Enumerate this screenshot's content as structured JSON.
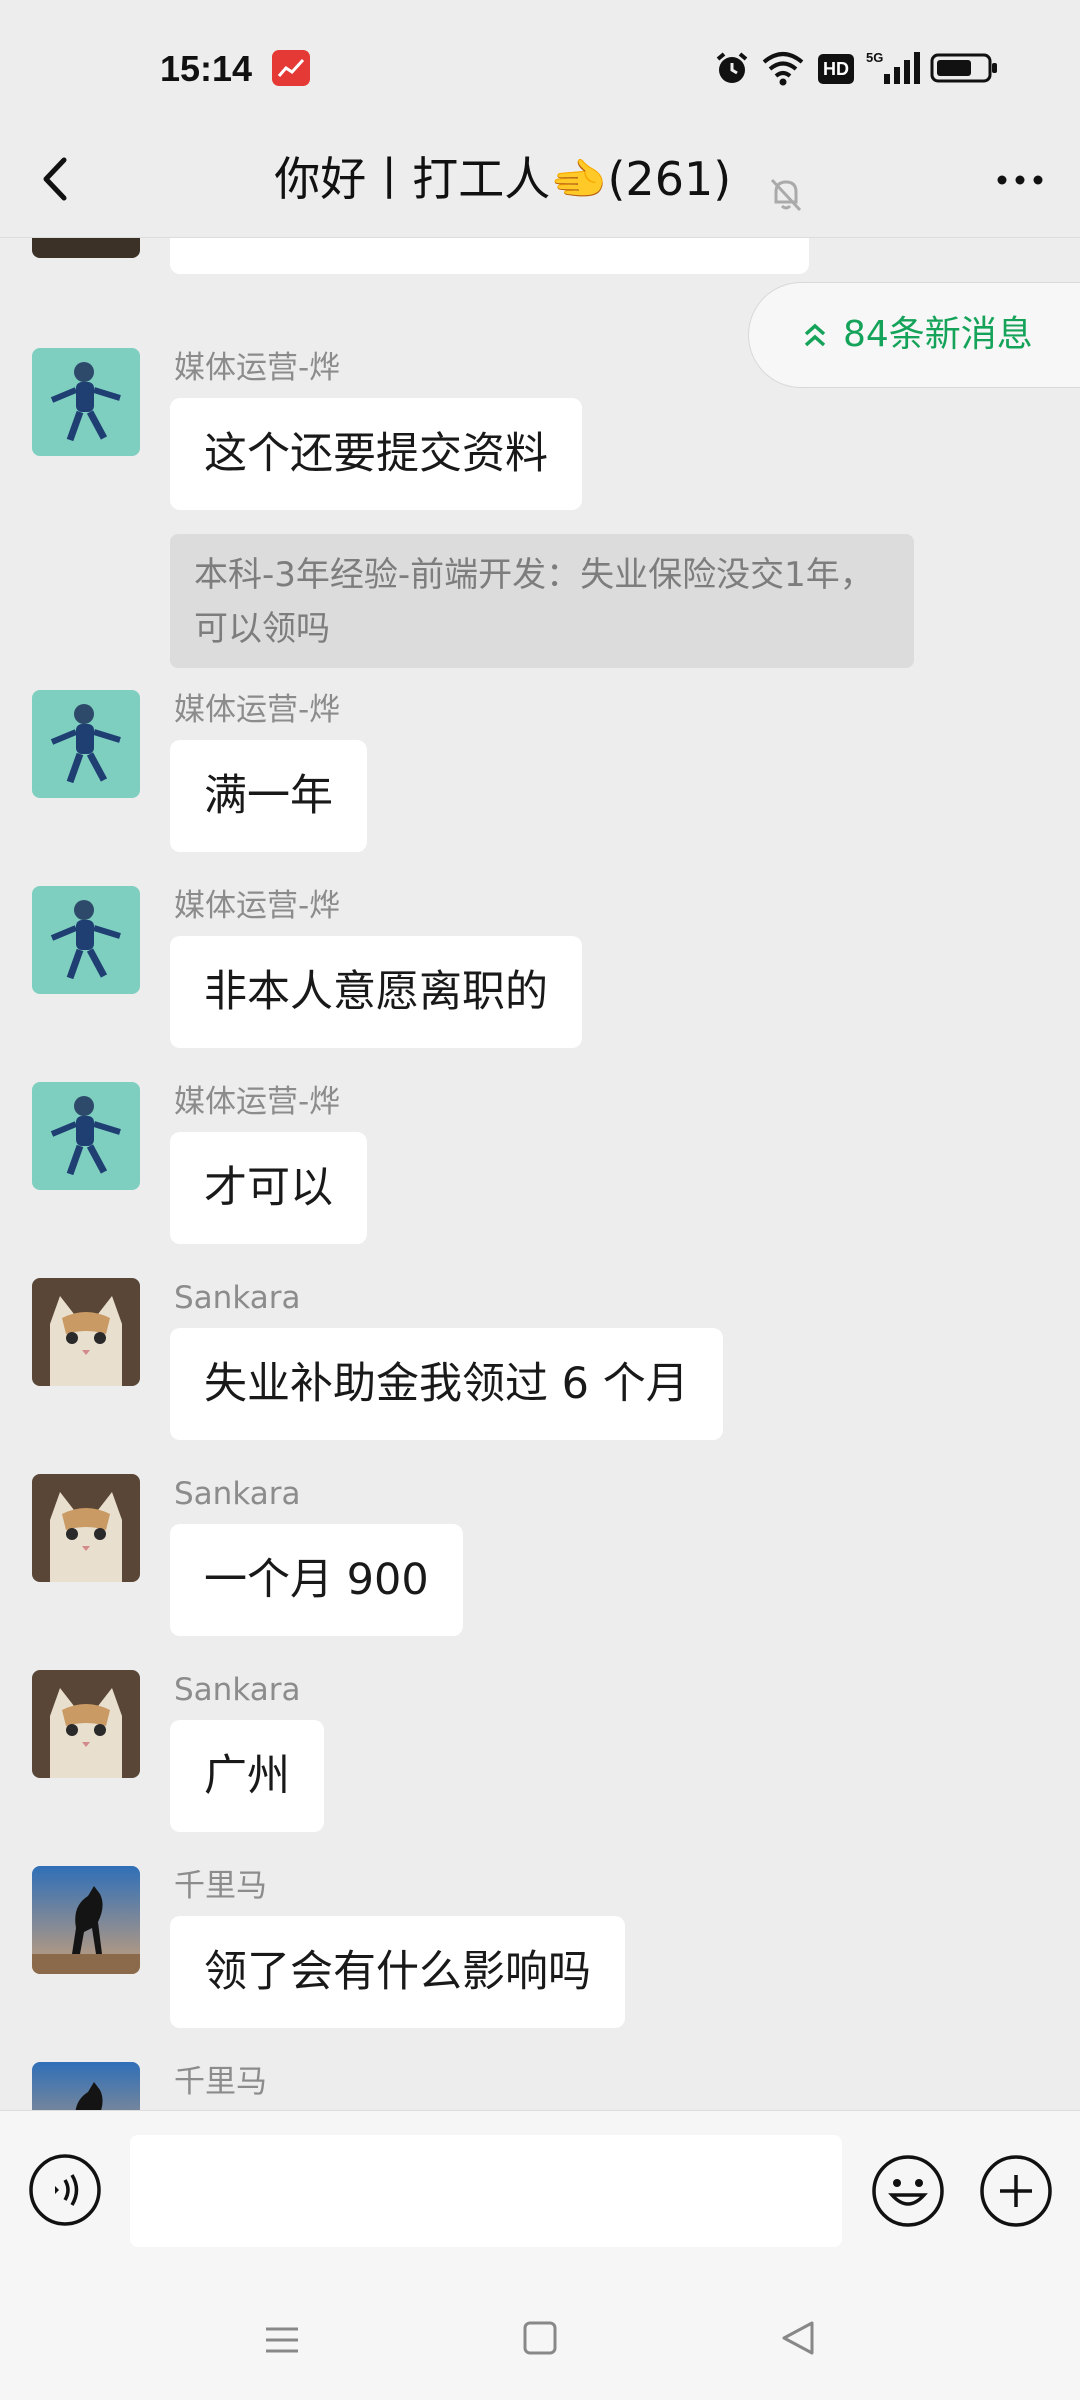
{
  "status_bar": {
    "time": "15:14",
    "hd_badge": "HD",
    "network": "5G",
    "icons": [
      "app-notification-icon",
      "alarm-icon",
      "wifi-icon",
      "signal-icon",
      "battery-icon"
    ]
  },
  "header": {
    "title": "你好丨打工人🫲(261)",
    "back_icon": "back-chevron-icon",
    "mute_icon": "bell-off-icon",
    "more_icon": "more-dots-icon"
  },
  "new_messages": {
    "label": "84条新消息",
    "accent": "#15a35a"
  },
  "messages": [
    {
      "sender": "",
      "text": "失业保险没交 1 年，可以领吗",
      "avatar": "partial-avatar"
    },
    {
      "sender": "媒体运营-烨",
      "text": "这个还要提交资料",
      "quote": "本科-3年经验-前端开发：失业保险没交1年，可以领吗",
      "avatar": "person-avatar"
    },
    {
      "sender": "媒体运营-烨",
      "text": "满一年",
      "avatar": "person-avatar"
    },
    {
      "sender": "媒体运营-烨",
      "text": "非本人意愿离职的",
      "avatar": "person-avatar"
    },
    {
      "sender": "媒体运营-烨",
      "text": "才可以",
      "avatar": "person-avatar"
    },
    {
      "sender": "Sankara",
      "text": "失业补助金我领过 6 个月",
      "avatar": "cat-avatar"
    },
    {
      "sender": "Sankara",
      "text": "一个月 900",
      "avatar": "cat-avatar"
    },
    {
      "sender": "Sankara",
      "text": "广州",
      "avatar": "cat-avatar"
    },
    {
      "sender": "千里马",
      "text": "领了会有什么影响吗",
      "avatar": "horse-avatar"
    },
    {
      "sender": "千里马",
      "text": "",
      "avatar": "horse-avatar"
    }
  ],
  "input_bar": {
    "value": "",
    "voice_icon": "voice-icon",
    "emoji_icon": "emoji-icon",
    "plus_icon": "plus-icon"
  },
  "nav_bar": {
    "icons": [
      "menu-icon",
      "home-icon",
      "back-triangle-icon"
    ]
  },
  "colors": {
    "background": "#ededed",
    "bubble": "#ffffff",
    "sender_name": "#8c8c8c",
    "quote_bg": "#dcdcdc"
  }
}
